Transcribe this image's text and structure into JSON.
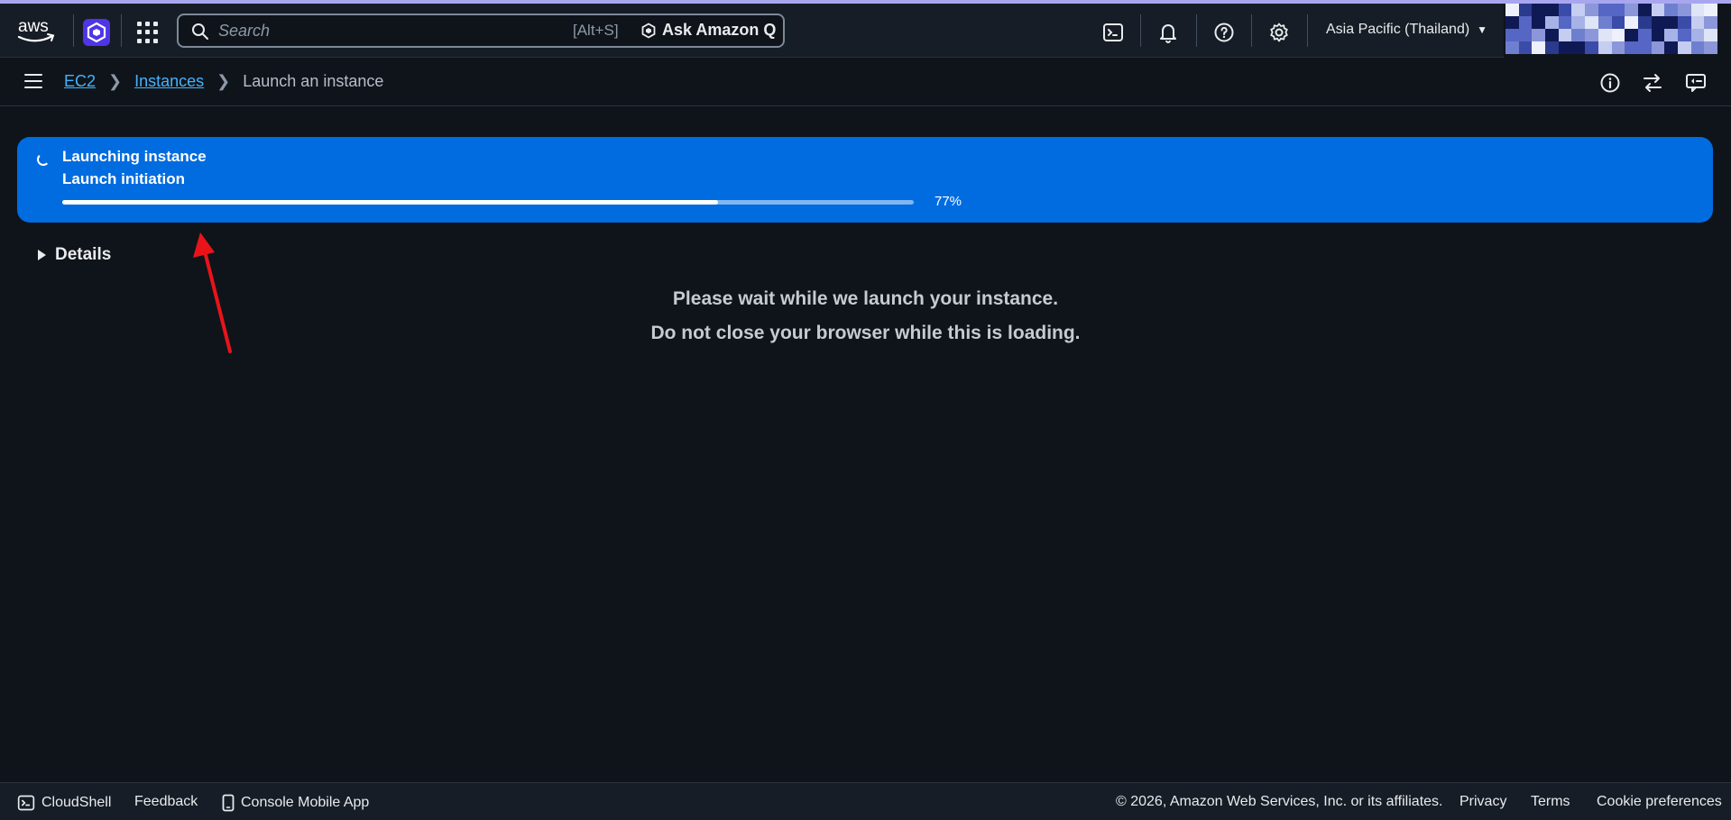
{
  "colors": {
    "accent": "#006ce0",
    "link": "#42b4ff",
    "background": "#0f141a",
    "header": "#161d26"
  },
  "header": {
    "logo": "aws",
    "search": {
      "placeholder": "Search",
      "shortcut": "[Alt+S]",
      "ask_q_label": "Ask Amazon Q"
    },
    "icons": [
      "cloudshell-icon",
      "bell-icon",
      "help-icon",
      "settings-icon"
    ],
    "region": "Asia Pacific (Thailand)"
  },
  "breadcrumb": {
    "items": [
      "EC2",
      "Instances"
    ],
    "current": "Launch an instance"
  },
  "flash": {
    "title": "Launching instance",
    "subtitle": "Launch initiation",
    "progress": 77,
    "progress_label": "77%"
  },
  "details_label": "Details",
  "messages": {
    "line1": "Please wait while we launch your instance.",
    "line2": "Do not close your browser while this is loading."
  },
  "footer": {
    "cloudshell": "CloudShell",
    "feedback": "Feedback",
    "mobile_app": "Console Mobile App",
    "copyright": "© 2026, Amazon Web Services, Inc. or its affiliates.",
    "privacy": "Privacy",
    "terms": "Terms",
    "cookies": "Cookie preferences"
  }
}
